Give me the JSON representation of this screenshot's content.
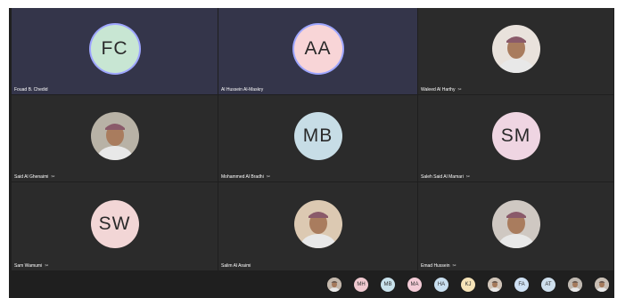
{
  "tiles": [
    {
      "name": "Fouad B. Chedid",
      "initials": "FC",
      "color": "#c8e6d3",
      "kind": "initials",
      "active": true,
      "mic": false
    },
    {
      "name": "Al Hussein Al-Maskry",
      "initials": "AA",
      "color": "#f8d5d7",
      "kind": "initials",
      "active": true,
      "mic": false
    },
    {
      "name": "Waleed Al Harthy",
      "initials": "",
      "color": "#e9e2dc",
      "kind": "photo",
      "active": false,
      "mic": true
    },
    {
      "name": "Said Al Ghenaimi",
      "initials": "",
      "color": "#b8b2a6",
      "kind": "photo",
      "active": false,
      "mic": true
    },
    {
      "name": "Mohammed Al Bradhi",
      "initials": "MB",
      "color": "#c7dde6",
      "kind": "initials",
      "active": false,
      "mic": true
    },
    {
      "name": "Saleh Said Al Mamari",
      "initials": "SM",
      "color": "#efd5e2",
      "kind": "initials",
      "active": false,
      "mic": true
    },
    {
      "name": "Sam Wamumi",
      "initials": "SW",
      "color": "#f2d6d6",
      "kind": "initials",
      "active": false,
      "mic": true
    },
    {
      "name": "Salim Al Araimi",
      "initials": "",
      "color": "#dcc9b2",
      "kind": "photo",
      "active": false,
      "mic": false
    },
    {
      "name": "Emad Hussein",
      "initials": "",
      "color": "#cfc8c2",
      "kind": "photo",
      "active": false,
      "mic": true
    }
  ],
  "strip": [
    {
      "initials": "",
      "color": "#c4b8ac",
      "kind": "photo"
    },
    {
      "initials": "MH",
      "color": "#f0c9d0",
      "kind": "initials"
    },
    {
      "initials": "MB",
      "color": "#c9e2ec",
      "kind": "initials"
    },
    {
      "initials": "MA",
      "color": "#f3cbd6",
      "kind": "initials"
    },
    {
      "initials": "HA",
      "color": "#c9dff0",
      "kind": "initials"
    },
    {
      "initials": "KJ",
      "color": "#f6e3b8",
      "kind": "initials"
    },
    {
      "initials": "",
      "color": "#d0c4b8",
      "kind": "photo"
    },
    {
      "initials": "FA",
      "color": "#cfe1f4",
      "kind": "initials"
    },
    {
      "initials": "AT",
      "color": "#cfe0ee",
      "kind": "initials"
    },
    {
      "initials": "",
      "color": "#bfb8b0",
      "kind": "photo"
    },
    {
      "initials": "",
      "color": "#c8beb4",
      "kind": "photo"
    }
  ]
}
